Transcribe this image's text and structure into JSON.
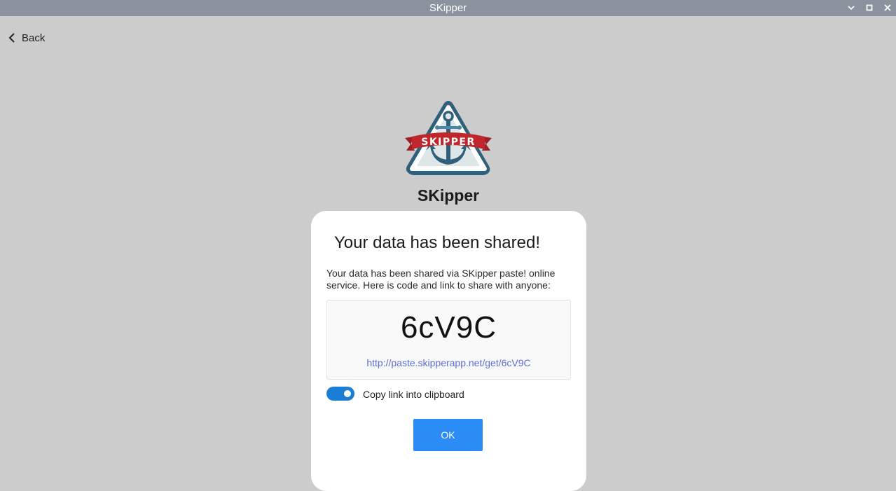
{
  "window": {
    "title": "SKipper",
    "controls": [
      "minimize-icon",
      "maximize-icon",
      "close-icon"
    ]
  },
  "nav": {
    "back_label": "Back",
    "back_icon": "chevron-left-icon"
  },
  "app": {
    "name": "SKipper",
    "logo_banner_text": "SKIPPER",
    "logo_icon": "anchor-icon"
  },
  "dialog": {
    "title": "Your data has been shared!",
    "message": "Your data has been shared via SKipper paste! online service. Here is code and link to share with anyone:",
    "code": "6cV9C",
    "link": "http://paste.skipperapp.net/get/6cV9C",
    "copy_toggle": {
      "label": "Copy link into clipboard",
      "on": true
    },
    "ok_label": "OK"
  },
  "colors": {
    "titlebar": "#8a939d",
    "background": "#cccccc",
    "toggle_on": "#1a7fd4",
    "ok_button": "#2b8cf6",
    "link": "#5b6fd6",
    "logo_red": "#c0272d",
    "logo_blue": "#2f5f7a"
  }
}
